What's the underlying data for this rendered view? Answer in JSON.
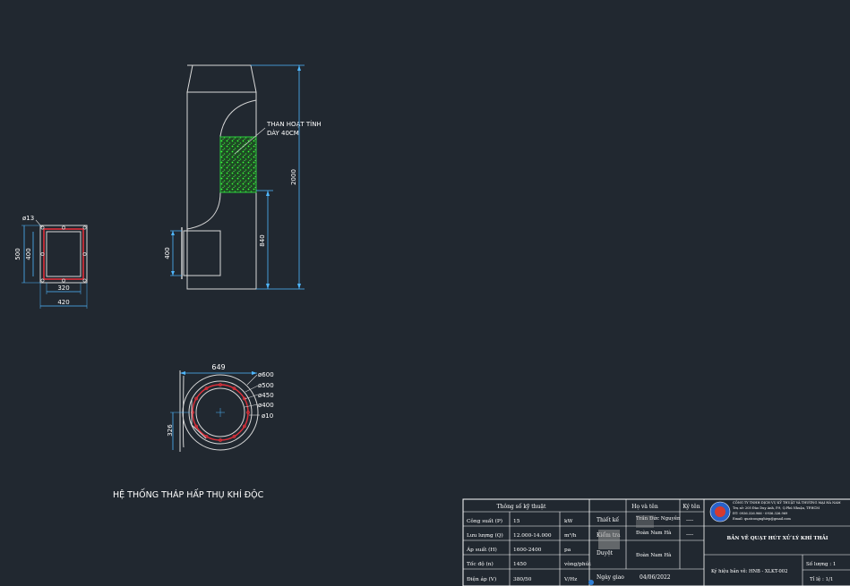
{
  "drawing": {
    "caption": "HỆ THỐNG THÁP HẤP THỤ KHÍ ĐỘC",
    "side_view": {
      "label_line1": "THAN HOẠT TÍNH",
      "label_line2": "DÀY 40CM",
      "dim_height": "2000",
      "dim_inlet_height": "840",
      "dim_inlet": "400"
    },
    "flange_view": {
      "dim_hole": "ø13",
      "dim_outer_h": "500",
      "dim_inner_h": "400",
      "dim_inner_w": "320",
      "dim_outer_w": "420"
    },
    "top_view": {
      "dim_width": "649",
      "dim_d600": "ø600",
      "dim_d500": "ø500",
      "dim_d450": "ø450",
      "dim_d400": "ø400",
      "dim_d10": "ø10",
      "dim_offset": "326"
    }
  },
  "title_block": {
    "specs_header": "Thông số kỹ thuật",
    "specs": [
      {
        "label": "Công suất (P)",
        "value": "15",
        "unit": "kW"
      },
      {
        "label": "Lưu lượng (Q)",
        "value": "12.000-14.000",
        "unit": "m³/h"
      },
      {
        "label": "Áp suất (H)",
        "value": "1600-2400",
        "unit": "pa"
      },
      {
        "label": "Tốc độ (n)",
        "value": "1450",
        "unit": "vòng/phút"
      },
      {
        "label": "Điện áp (V)",
        "value": "380/50",
        "unit": "V/Hz"
      }
    ],
    "people_header_name": "Họ và tên",
    "people_header_sign": "Ký tên",
    "people": [
      {
        "role": "Thiết kế",
        "name": "Trần Đức Nguyên",
        "sign": "----"
      },
      {
        "role": "Kiểm tra",
        "name": "Đoàn Nam Hà",
        "sign": "----"
      },
      {
        "role": "Duyệt",
        "name": "Đoàn Nam Hà",
        "sign": ""
      }
    ],
    "date_label": "Ngày giao",
    "date_value": "04/06/2022",
    "company_line1": "CÔNG TY TNHH DỊCH VỤ KỸ THUẬT VÀ THƯƠNG MẠI HÀ NAM",
    "company_line2": "Trụ sở: 205 Đào Duy Anh, P.9, Q.Phú Nhuận, TP.HCM",
    "company_line3": "ĐT: 0936.326.966 - 0936.326.969",
    "company_line4": "Email: quatcongnghiep@gmail.com",
    "sheet_title": "BẢN VẼ QUẠT HÚT XỬ LÝ KHÍ THẢI",
    "code_label": "Ký hiệu bản vẽ: HNB - XLKT-002",
    "sheets": "Số lượng : 1",
    "scale": "Tỉ lệ : 1/1"
  }
}
